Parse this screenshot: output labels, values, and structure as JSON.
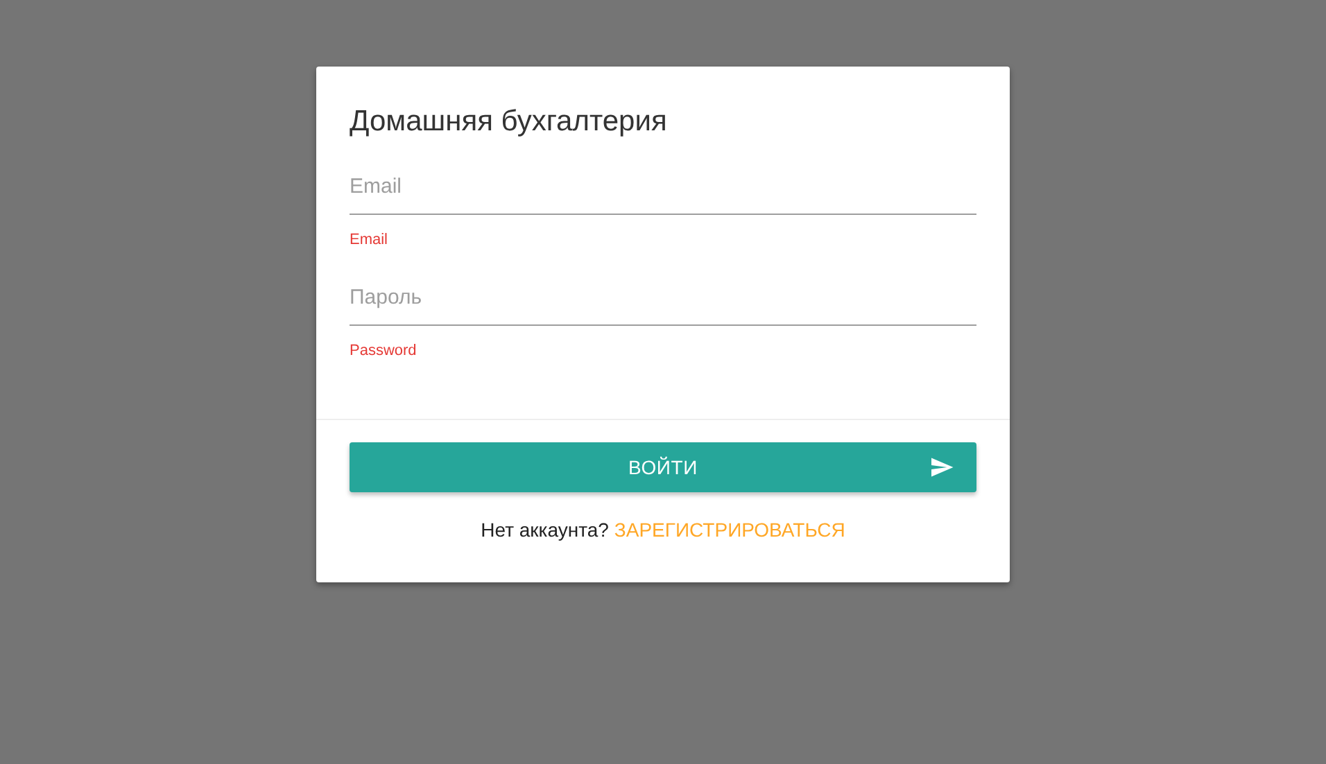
{
  "card": {
    "title": "Домашняя бухгалтерия",
    "fields": [
      {
        "placeholder": "Email",
        "helper": "Email"
      },
      {
        "placeholder": "Пароль",
        "helper": "Password"
      }
    ],
    "submit": {
      "label": "ВОЙТИ"
    },
    "register": {
      "text": "Нет аккаунта?",
      "link": "ЗАРЕГИСТРИРОВАТЬСЯ"
    }
  }
}
